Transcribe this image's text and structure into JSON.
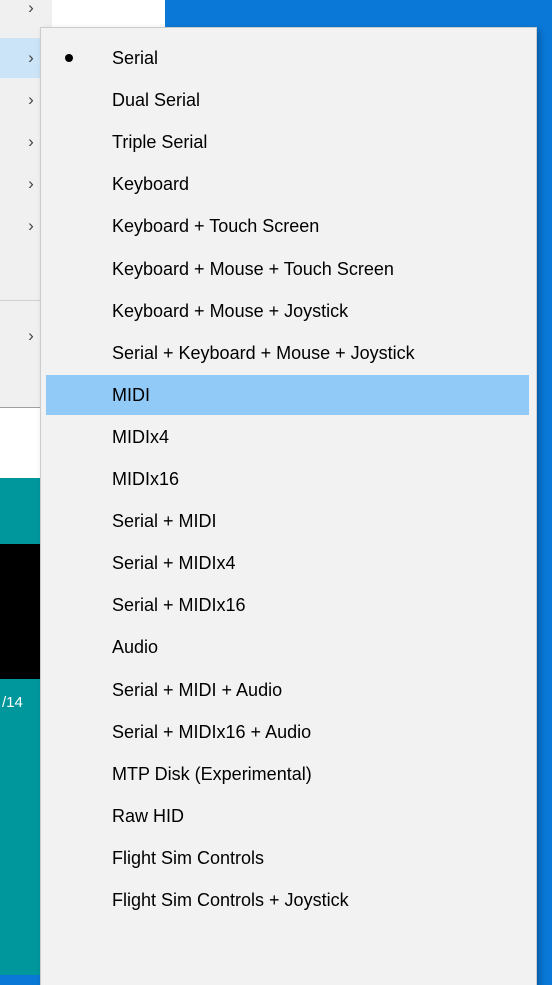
{
  "background": {
    "status_text": "/14"
  },
  "menu": {
    "selected_index": 0,
    "highlighted_index": 8,
    "items": [
      {
        "label": "Serial"
      },
      {
        "label": "Dual Serial"
      },
      {
        "label": "Triple Serial"
      },
      {
        "label": "Keyboard"
      },
      {
        "label": "Keyboard + Touch Screen"
      },
      {
        "label": "Keyboard + Mouse + Touch Screen"
      },
      {
        "label": "Keyboard + Mouse + Joystick"
      },
      {
        "label": "Serial + Keyboard + Mouse + Joystick"
      },
      {
        "label": "MIDI"
      },
      {
        "label": "MIDIx4"
      },
      {
        "label": "MIDIx16"
      },
      {
        "label": "Serial + MIDI"
      },
      {
        "label": "Serial + MIDIx4"
      },
      {
        "label": "Serial + MIDIx16"
      },
      {
        "label": "Audio"
      },
      {
        "label": "Serial + MIDI + Audio"
      },
      {
        "label": "Serial + MIDIx16 + Audio"
      },
      {
        "label": "MTP Disk (Experimental)"
      },
      {
        "label": "Raw HID"
      },
      {
        "label": "Flight Sim Controls"
      },
      {
        "label": "Flight Sim Controls + Joystick"
      }
    ]
  },
  "colors": {
    "desktop": "#0a78d7",
    "menu_background": "#f2f2f2",
    "highlight": "#91c9f7",
    "ide_teal": "#00979c"
  }
}
